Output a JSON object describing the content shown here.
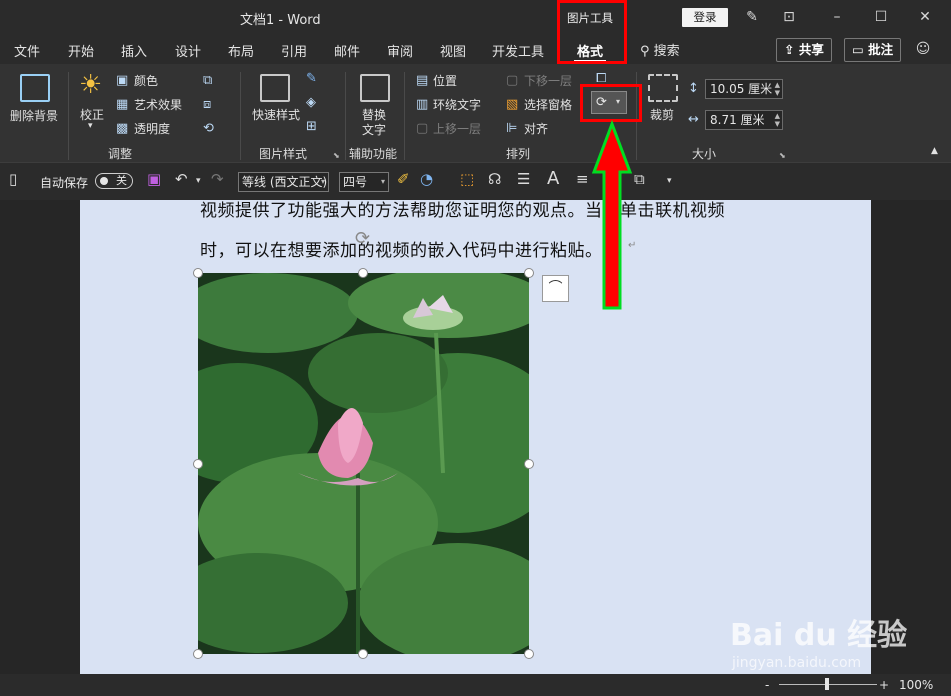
{
  "titlebar": {
    "doc_title": "文档1  -  Word",
    "context_tool": "图片工具",
    "login_label": "登录"
  },
  "tabs": [
    {
      "label": "文件"
    },
    {
      "label": "开始"
    },
    {
      "label": "插入"
    },
    {
      "label": "设计"
    },
    {
      "label": "布局"
    },
    {
      "label": "引用"
    },
    {
      "label": "邮件"
    },
    {
      "label": "审阅"
    },
    {
      "label": "视图"
    },
    {
      "label": "开发工具"
    },
    {
      "label": "格式",
      "active": true
    }
  ],
  "search_label": "搜索",
  "share_label": "共享",
  "comment_label": "批注",
  "ribbon": {
    "remove_bg": "删除背景",
    "correct": "校正",
    "color": "颜色",
    "art_effects": "艺术效果",
    "transparency": "透明度",
    "quick_styles": "快速样式",
    "alt_text_1": "替换",
    "alt_text_2": "文字",
    "position": "位置",
    "wrap_text": "环绕文字",
    "send_backward": "下移一层",
    "bring_forward": "上移一层",
    "selection_pane": "选择窗格",
    "align": "对齐",
    "crop": "裁剪",
    "height_value": "10.05 厘米",
    "width_value": "8.71 厘米",
    "groups": {
      "adjust": "调整",
      "picture_styles": "图片样式",
      "accessibility": "辅助功能",
      "arrange": "排列",
      "size": "大小"
    }
  },
  "qat": {
    "autosave": "自动保存",
    "autosave_state": "关",
    "font_name": "等线 (西文正文)",
    "font_size": "四号"
  },
  "document": {
    "line1": "视频提供了功能强大的方法帮助您证明您的观点。当您单击联机视频",
    "line2": "时，可以在想要添加的视频的嵌入代码中进行粘贴。"
  },
  "status": {
    "zoom": "100%",
    "zoom_percent": 100
  },
  "watermark": {
    "brand": "Bai du 经验",
    "url": "jingyan.baidu.com"
  },
  "colors": {
    "highlight": "#ff0000",
    "arrow_fill": "#ff0000",
    "arrow_outline": "#00dd22",
    "page_bg": "#d9e2f3"
  }
}
